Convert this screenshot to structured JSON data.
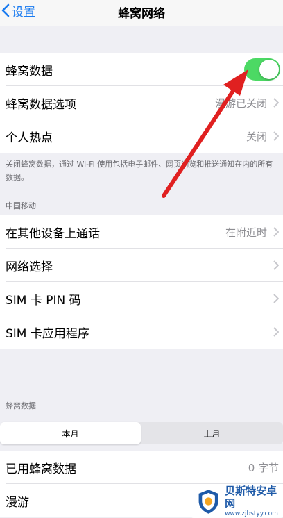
{
  "nav": {
    "back_label": "设置",
    "title": "蜂窝网络"
  },
  "main_group": [
    {
      "label": "蜂窝数据",
      "value": "",
      "toggle_on": true
    },
    {
      "label": "蜂窝数据选项",
      "value": "漫游已关闭"
    },
    {
      "label": "个人热点",
      "value": "关闭"
    }
  ],
  "note_text": "关闭蜂窝数据，通过 Wi-Fi 使用包括电子邮件、网页浏览和推送通知在内的所有数据。",
  "carrier_header": "中国移动",
  "carrier_group": [
    {
      "label": "在其他设备上通话",
      "value": "在附近时"
    },
    {
      "label": "网络选择",
      "value": ""
    },
    {
      "label": "SIM 卡 PIN 码",
      "value": ""
    },
    {
      "label": "SIM 卡应用程序",
      "value": ""
    }
  ],
  "data_header": "蜂窝数据",
  "segments": [
    "本月",
    "上月"
  ],
  "usage_group": [
    {
      "label": "已用蜂窝数据",
      "value": "0 字节"
    },
    {
      "label": "漫游",
      "value": ""
    }
  ],
  "watermark": {
    "name": "贝斯特安卓网",
    "url": "www.zjbstyy.com"
  },
  "colors": {
    "accent": "#1a7bf0",
    "toggle_on": "#4cd964",
    "annotation_arrow": "#e02020"
  }
}
